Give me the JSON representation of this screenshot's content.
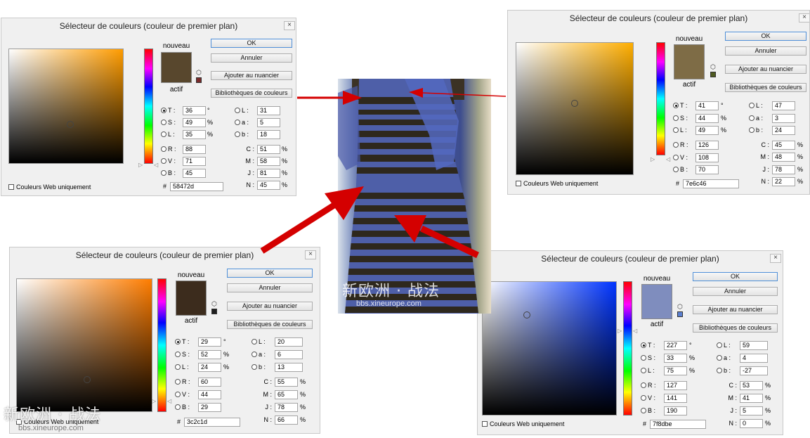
{
  "dialog_title": "Sélecteur de couleurs (couleur de premier plan)",
  "close_glyph": "×",
  "labels": {
    "nouveau": "nouveau",
    "actif": "actif",
    "ok": "OK",
    "annuler": "Annuler",
    "ajouter": "Ajouter au nuancier",
    "bibliotheques": "Bibliothèques de couleurs",
    "web_only": "Couleurs Web uniquement",
    "hash": "#",
    "T": "T :",
    "S": "S :",
    "L": "L :",
    "R": "R :",
    "V": "V :",
    "B": "B :",
    "L2": "L :",
    "a": "a :",
    "b": "b :",
    "C": "C :",
    "M": "M :",
    "J": "J :",
    "N": "N :",
    "deg": "°",
    "pct": "%"
  },
  "dialogs": [
    {
      "id": "top-left",
      "field_hue_color": "#ff9c00",
      "field_cursor": [
        0.54,
        0.66
      ],
      "hue_marker": 0.9,
      "swatch_color": "#58472d",
      "mini_color": "#7a2a2a",
      "T": "36",
      "S": "49",
      "Lb": "35",
      "R": "88",
      "V": "71",
      "B": "45",
      "L": "31",
      "a": "5",
      "b": "18",
      "C": "51",
      "M": "58",
      "J": "81",
      "N": "45",
      "hex": "58472d"
    },
    {
      "id": "top-right",
      "field_hue_color": "#ffae00",
      "field_cursor": [
        0.5,
        0.46
      ],
      "hue_marker": 0.88,
      "swatch_color": "#7e6c46",
      "mini_color": "#4f5a20",
      "T": "41",
      "S": "44",
      "Lb": "49",
      "R": "126",
      "V": "108",
      "B": "70",
      "L": "47",
      "a": "3",
      "b": "24",
      "C": "45",
      "M": "48",
      "J": "78",
      "N": "22",
      "hex": "7e6c46"
    },
    {
      "id": "bottom-left",
      "field_hue_color": "#ff7d00",
      "field_cursor": [
        0.52,
        0.76
      ],
      "hue_marker": 0.92,
      "swatch_color": "#3c2c1d",
      "mini_color": "#1e1e1e",
      "T": "29",
      "S": "52",
      "Lb": "24",
      "R": "60",
      "V": "44",
      "B": "29",
      "L": "20",
      "a": "6",
      "b": "13",
      "C": "55",
      "M": "65",
      "J": "78",
      "N": "66",
      "hex": "3c2c1d"
    },
    {
      "id": "bottom-right",
      "field_hue_color": "#0034ff",
      "field_cursor": [
        0.33,
        0.25
      ],
      "hue_marker": 0.37,
      "swatch_color": "#7f8dbe",
      "mini_color": "#5a7fd0",
      "T": "227",
      "S": "33",
      "Lb": "75",
      "R": "127",
      "V": "141",
      "B": "190",
      "L": "59",
      "a": "4",
      "b": "-27",
      "C": "53",
      "M": "41",
      "J": "5",
      "N": "0",
      "hex": "7f8dbe"
    }
  ],
  "watermark": {
    "chinese": "新欧洲 · 战法",
    "url": "bbs.xineurope.com"
  },
  "colors": {
    "arrow": "#d40000",
    "dialog_bg": "#f0f0f0",
    "ok_border": "#4f8fd8"
  }
}
